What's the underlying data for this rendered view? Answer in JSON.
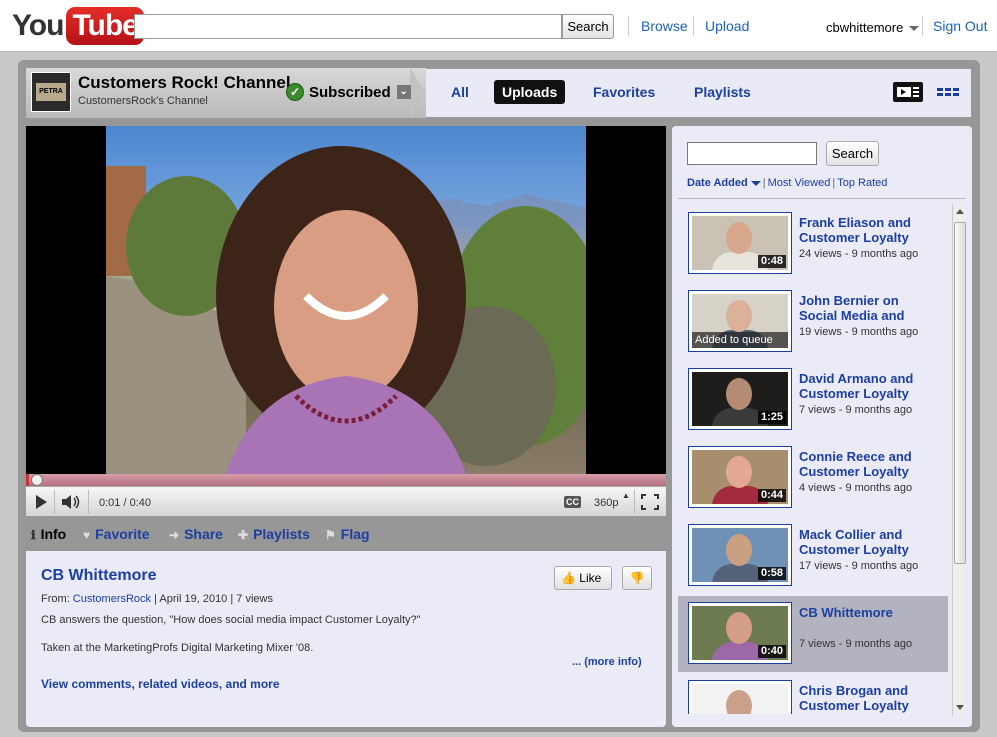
{
  "header": {
    "logo_you": "You",
    "logo_tube": "Tube",
    "search_button": "Search",
    "search_value": "",
    "links": [
      "Browse",
      "Upload"
    ],
    "username": "cbwhittemore",
    "signout": "Sign Out"
  },
  "channel": {
    "thumb_text": "PETRA",
    "title": "Customers Rock! Channel",
    "subtitle": "CustomersRock's Channel",
    "subscribed_label": "Subscribed",
    "tabs": [
      {
        "label": "All",
        "active": false
      },
      {
        "label": "Uploads",
        "active": true
      },
      {
        "label": "Favorites",
        "active": false
      },
      {
        "label": "Playlists",
        "active": false
      }
    ]
  },
  "player": {
    "progress": 0.0042,
    "time_current": "0:01",
    "time_total": "0:40",
    "time_display": "0:01 / 0:40",
    "cc_label": "CC",
    "quality": "360p"
  },
  "info_tabs": [
    {
      "label": "Info",
      "icon": "info-icon",
      "active": true
    },
    {
      "label": "Favorite",
      "icon": "heart-icon",
      "active": false
    },
    {
      "label": "Share",
      "icon": "arrow-icon",
      "active": false
    },
    {
      "label": "Playlists",
      "icon": "plus-icon",
      "active": false
    },
    {
      "label": "Flag",
      "icon": "flag-icon",
      "active": false
    }
  ],
  "video_info": {
    "title": "CB Whittemore",
    "from_label": "From:",
    "from_user": "CustomersRock",
    "date": "April 19, 2010",
    "views": "7 views",
    "description_1": "CB answers the question, \"How does social media impact Customer Loyalty?\"",
    "description_2": "Taken at the MarketingProfs Digital Marketing Mixer '08.",
    "more_info": "... (more info)",
    "view_comments": "View comments, related videos, and more",
    "like_label": "Like"
  },
  "sidebar": {
    "search_button": "Search",
    "search_value": "",
    "sort": [
      "Date Added",
      "Most Viewed",
      "Top Rated"
    ],
    "videos": [
      {
        "title": "Frank Eliason and Customer Loyalty",
        "meta": "24 views - 9 months ago",
        "duration": "0:48",
        "queued": "",
        "selected": false,
        "thumb_bg": "#c9c2b5",
        "face": "#d7a88c",
        "shirt": "#e8e4dc"
      },
      {
        "title": "John Bernier on Social Media and",
        "meta": "19 views - 9 months ago",
        "duration": "",
        "queued": "Added to queue",
        "selected": false,
        "thumb_bg": "#d7d2c8",
        "face": "#dcb19a",
        "shirt": "#4d5a70"
      },
      {
        "title": "David Armano and Customer Loyalty",
        "meta": "7 views - 9 months ago",
        "duration": "1:25",
        "queued": "",
        "selected": false,
        "thumb_bg": "#1e1d1c",
        "face": "#b48c74",
        "shirt": "#3a3a3a"
      },
      {
        "title": "Connie Reece and Customer Loyalty",
        "meta": "4 views - 9 months ago",
        "duration": "0:44",
        "queued": "",
        "selected": false,
        "thumb_bg": "#a78f6d",
        "face": "#e2a893",
        "shirt": "#a22b3c"
      },
      {
        "title": "Mack Collier and Customer Loyalty",
        "meta": "17 views - 9 months ago",
        "duration": "0:58",
        "queued": "",
        "selected": false,
        "thumb_bg": "#6f91b6",
        "face": "#caa083",
        "shirt": "#56627a"
      },
      {
        "title": "CB Whittemore",
        "meta": "7 views - 9 months ago",
        "duration": "0:40",
        "queued": "",
        "selected": true,
        "thumb_bg": "#6c7a52",
        "face": "#d39e87",
        "shirt": "#9c68a6"
      },
      {
        "title": "Chris Brogan and Customer Loyalty",
        "meta": "",
        "duration": "",
        "queued": "",
        "selected": false,
        "thumb_bg": "#f2f2f2",
        "face": "#caa08a",
        "shirt": "#333"
      }
    ]
  },
  "colors": {
    "link": "#1c3fa0",
    "youtube_red": "#d5202a"
  }
}
